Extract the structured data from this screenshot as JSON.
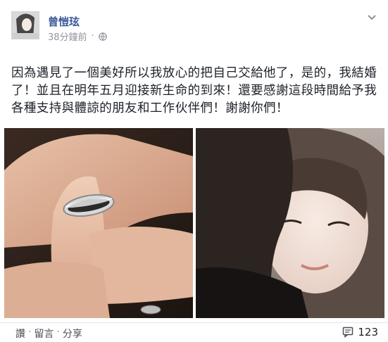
{
  "post": {
    "author": "曾愷玹",
    "timestamp": "38分鐘前",
    "visibility_icon": "globe-icon",
    "text": "因為遇見了一個美好所以我放心的把自己交給他了，是的，我結婚了！並且在明年五月迎接新生命的到來！還要感謝這段時間給予我各種支持與體諒的朋友和工作伙伴們！謝謝你們！"
  },
  "footer": {
    "actions": [
      "讚",
      "留言",
      "分享"
    ],
    "separator": "·",
    "comment_count": "123"
  },
  "colors": {
    "author": "#3b5998",
    "meta": "#90949c",
    "text": "#1d2129"
  }
}
